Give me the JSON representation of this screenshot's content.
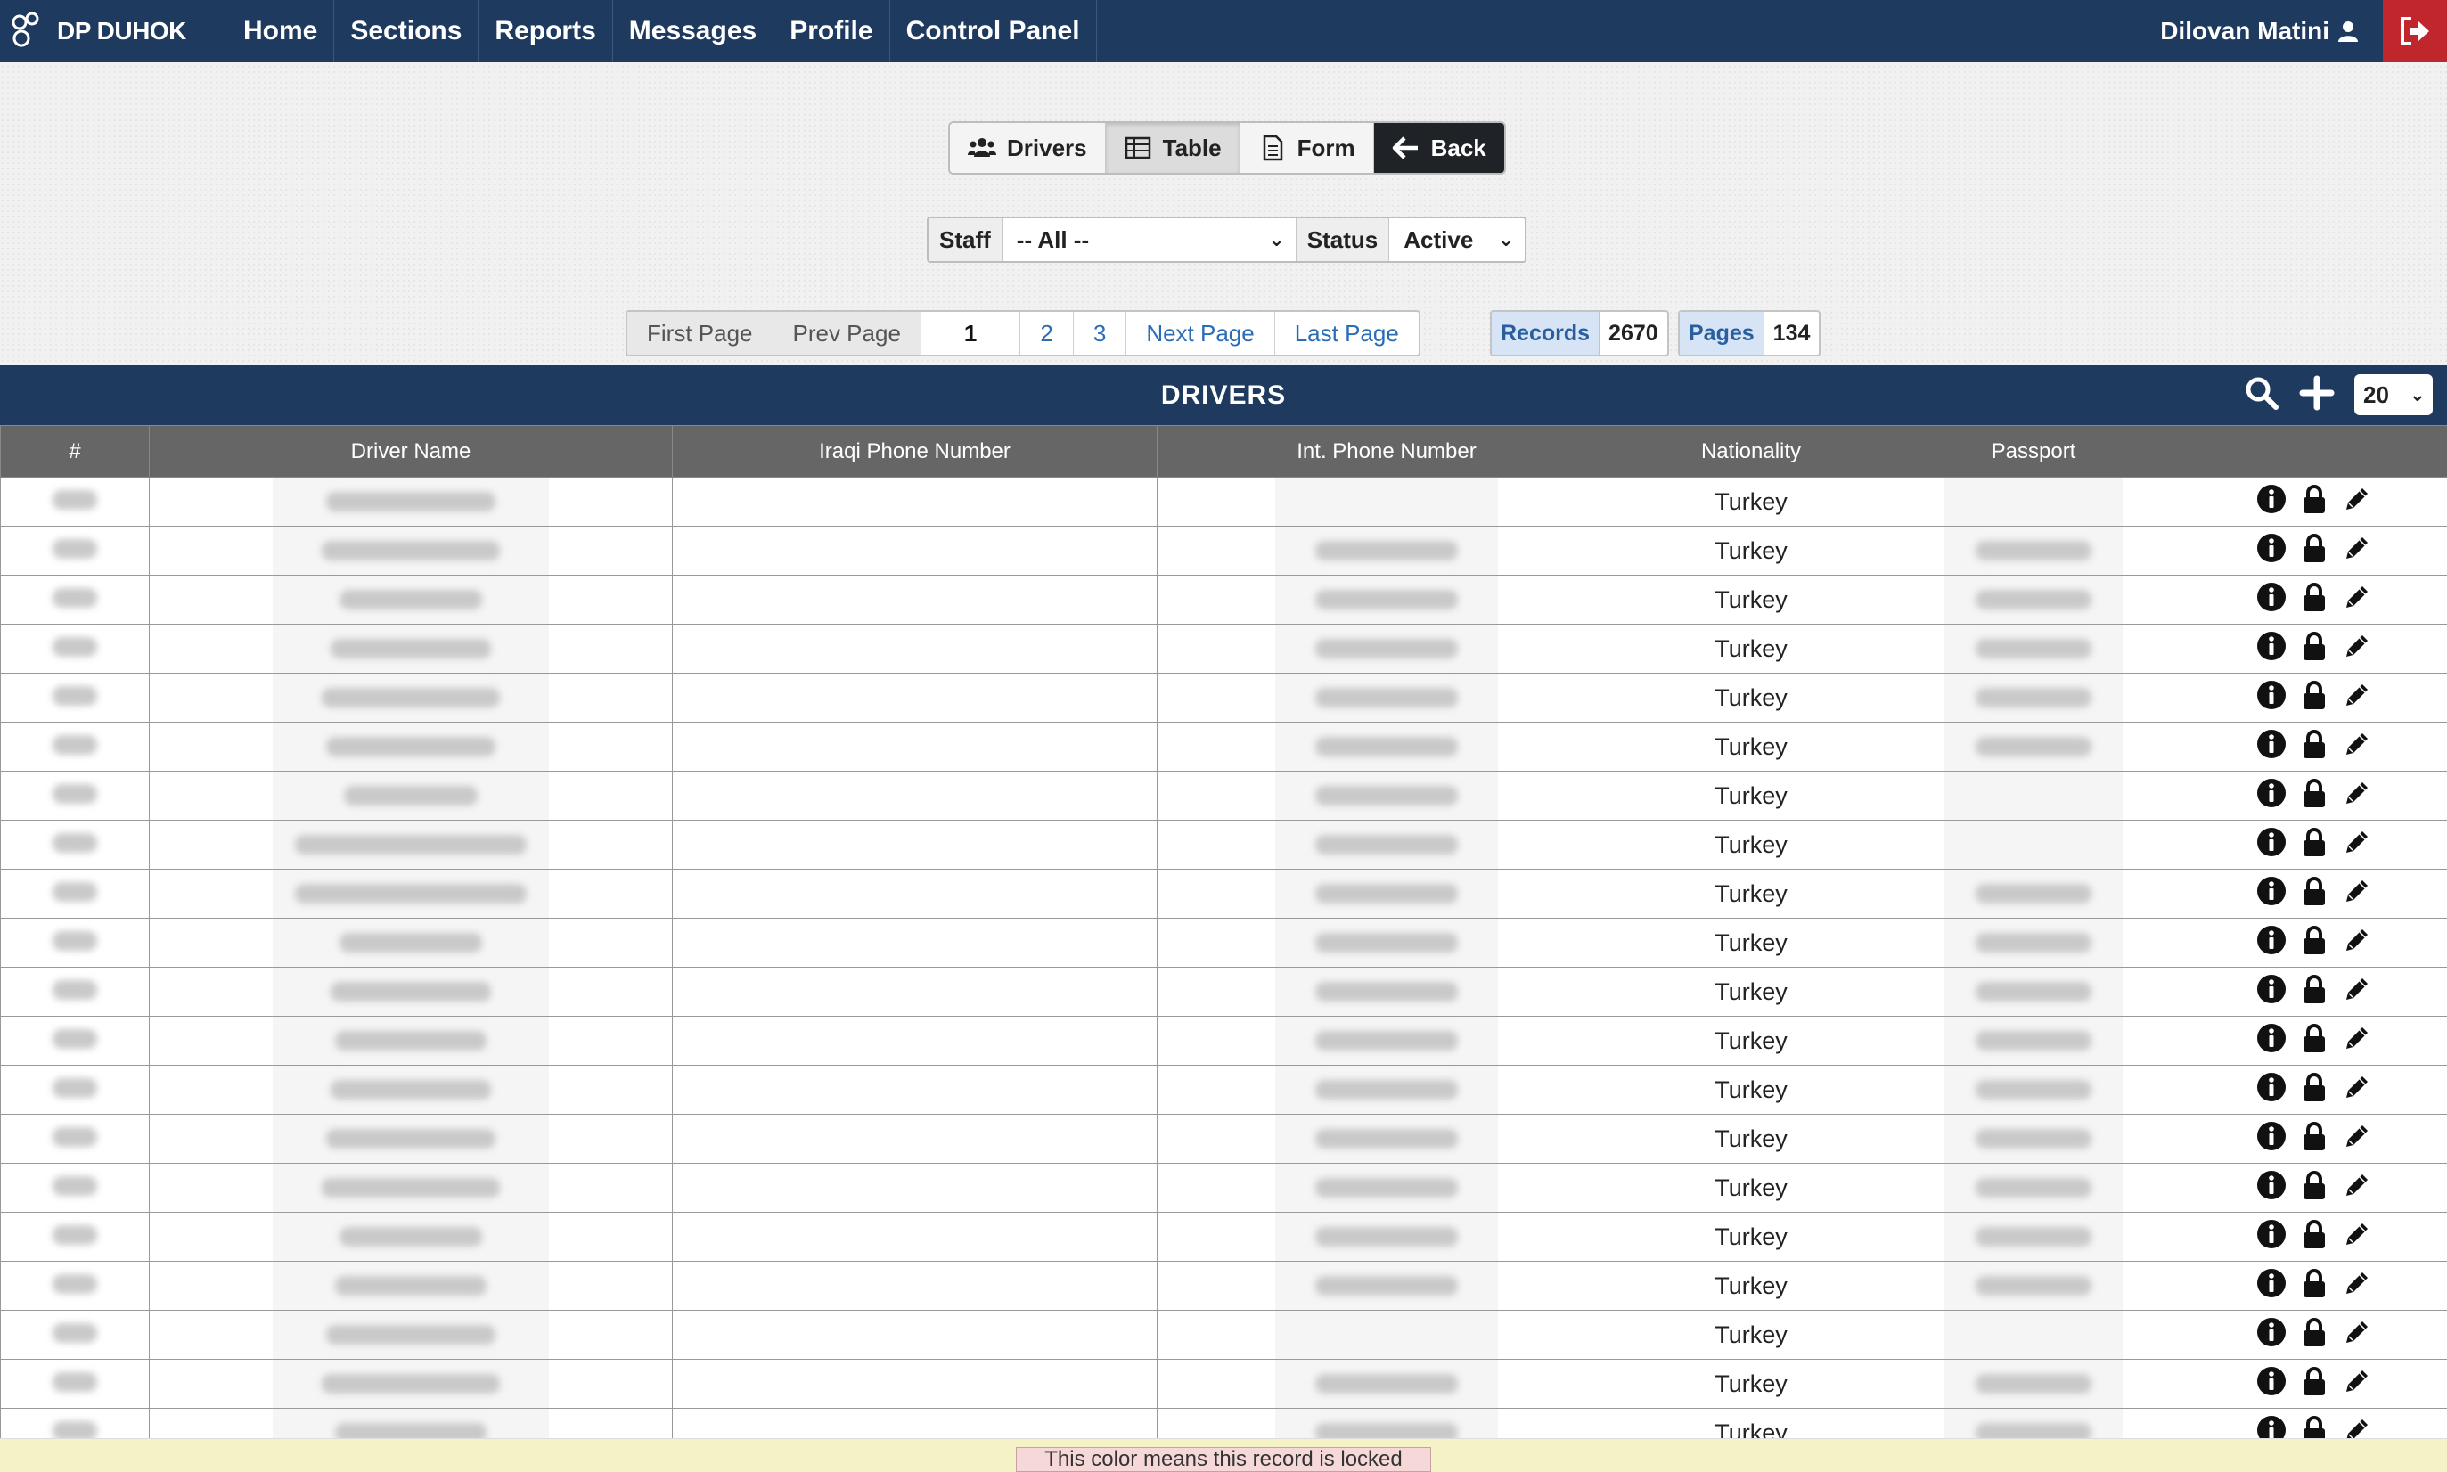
{
  "brand": {
    "name": "DP DUHOK"
  },
  "nav": {
    "items": [
      "Home",
      "Sections",
      "Reports",
      "Messages",
      "Profile",
      "Control Panel"
    ]
  },
  "user": {
    "name": "Dilovan Matini"
  },
  "buttons": {
    "drivers": "Drivers",
    "table": "Table",
    "form": "Form",
    "back": "Back"
  },
  "filters": {
    "staff_label": "Staff",
    "staff_value": "-- All --",
    "status_label": "Status",
    "status_value": "Active"
  },
  "pager": {
    "first": "First Page",
    "prev": "Prev Page",
    "current": "1",
    "p2": "2",
    "p3": "3",
    "next": "Next Page",
    "last": "Last Page",
    "records_label": "Records",
    "records_value": "2670",
    "pages_label": "Pages",
    "pages_value": "134"
  },
  "table": {
    "title": "DRIVERS",
    "page_size": "20",
    "columns": [
      "#",
      "Driver Name",
      "Iraqi Phone Number",
      "Int. Phone Number",
      "Nationality",
      "Passport"
    ],
    "rows": [
      {
        "nationality": "Turkey",
        "has_phone": false,
        "has_passport": false
      },
      {
        "nationality": "Turkey",
        "has_phone": true,
        "has_passport": true
      },
      {
        "nationality": "Turkey",
        "has_phone": true,
        "has_passport": true
      },
      {
        "nationality": "Turkey",
        "has_phone": true,
        "has_passport": true
      },
      {
        "nationality": "Turkey",
        "has_phone": true,
        "has_passport": true
      },
      {
        "nationality": "Turkey",
        "has_phone": true,
        "has_passport": true
      },
      {
        "nationality": "Turkey",
        "has_phone": true,
        "has_passport": false
      },
      {
        "nationality": "Turkey",
        "has_phone": true,
        "has_passport": false
      },
      {
        "nationality": "Turkey",
        "has_phone": true,
        "has_passport": true
      },
      {
        "nationality": "Turkey",
        "has_phone": true,
        "has_passport": true
      },
      {
        "nationality": "Turkey",
        "has_phone": true,
        "has_passport": true
      },
      {
        "nationality": "Turkey",
        "has_phone": true,
        "has_passport": true
      },
      {
        "nationality": "Turkey",
        "has_phone": true,
        "has_passport": true
      },
      {
        "nationality": "Turkey",
        "has_phone": true,
        "has_passport": true
      },
      {
        "nationality": "Turkey",
        "has_phone": true,
        "has_passport": true
      },
      {
        "nationality": "Turkey",
        "has_phone": true,
        "has_passport": true
      },
      {
        "nationality": "Turkey",
        "has_phone": true,
        "has_passport": true
      },
      {
        "nationality": "Turkey",
        "has_phone": false,
        "has_passport": false
      },
      {
        "nationality": "Turkey",
        "has_phone": true,
        "has_passport": true
      },
      {
        "nationality": "Turkey",
        "has_phone": true,
        "has_passport": true
      }
    ]
  },
  "legend": {
    "text": "This color means this record is locked"
  },
  "icons": {
    "drivers": "users-icon",
    "table": "table-icon",
    "form": "file-icon",
    "back": "arrow-left-icon",
    "user": "user-icon",
    "logout": "sign-out-icon",
    "search": "search-icon",
    "add": "plus-icon",
    "info": "info-circle-icon",
    "lock": "lock-icon",
    "edit": "pencil-icon"
  },
  "colors": {
    "navbar": "#1f3a5f",
    "logout": "#c0272d",
    "header": "#666666",
    "legend": "#f6d8d8",
    "footer": "#f5f2c8"
  }
}
